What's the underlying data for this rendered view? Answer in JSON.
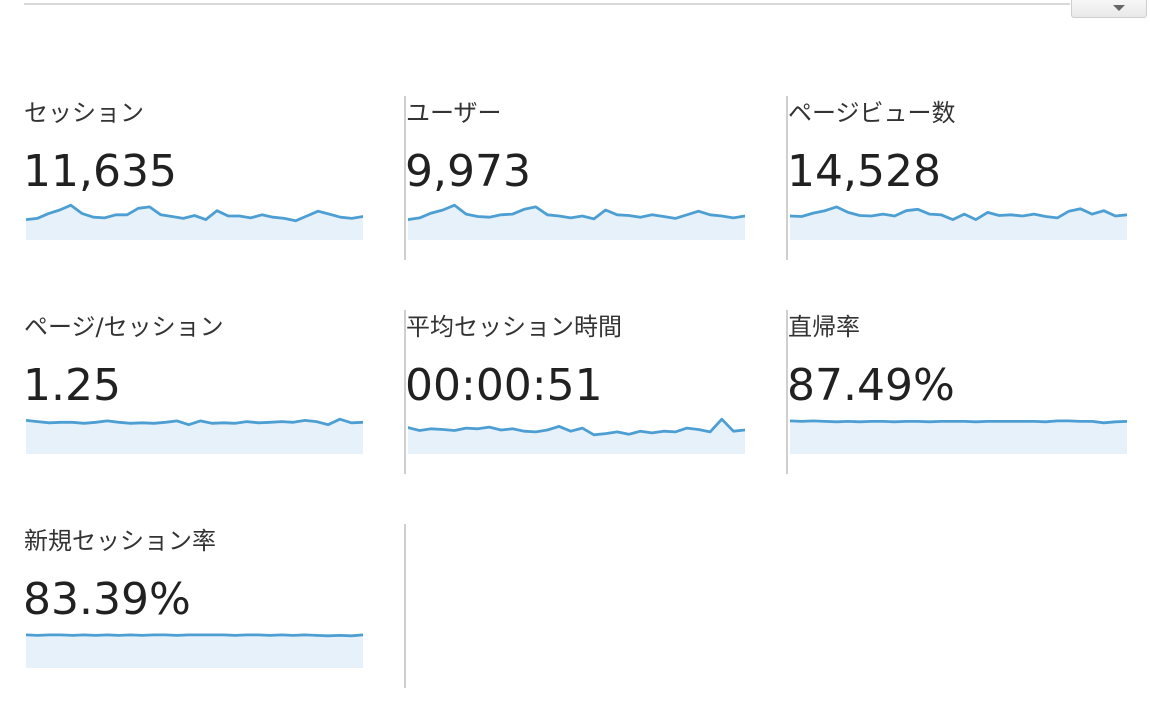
{
  "colors": {
    "accent": "#4d9fd3",
    "area_fill": "#e7f1fa",
    "divider": "#cfcfcf",
    "text": "#222222"
  },
  "toolbar": {
    "dropdown_icon": "chevron-down-icon"
  },
  "metrics": [
    {
      "id": "sessions",
      "label": "セッション",
      "value": "11,635",
      "trend": [
        0.35,
        0.4,
        0.6,
        0.75,
        0.95,
        0.6,
        0.45,
        0.42,
        0.55,
        0.55,
        0.82,
        0.88,
        0.55,
        0.48,
        0.4,
        0.52,
        0.35,
        0.72,
        0.5,
        0.5,
        0.42,
        0.55,
        0.45,
        0.4,
        0.3,
        0.5,
        0.7,
        0.58,
        0.45,
        0.4,
        0.48
      ]
    },
    {
      "id": "users",
      "label": "ユーザー",
      "value": "9,973",
      "trend": [
        0.35,
        0.42,
        0.62,
        0.75,
        0.95,
        0.58,
        0.48,
        0.45,
        0.55,
        0.58,
        0.78,
        0.88,
        0.55,
        0.5,
        0.42,
        0.5,
        0.38,
        0.75,
        0.55,
        0.52,
        0.45,
        0.55,
        0.48,
        0.4,
        0.55,
        0.7,
        0.55,
        0.5,
        0.42,
        0.5
      ]
    },
    {
      "id": "pageviews",
      "label": "ページビュー数",
      "value": "14,528",
      "trend": [
        0.5,
        0.48,
        0.62,
        0.72,
        0.88,
        0.65,
        0.52,
        0.5,
        0.58,
        0.5,
        0.72,
        0.78,
        0.58,
        0.55,
        0.35,
        0.58,
        0.35,
        0.65,
        0.52,
        0.55,
        0.5,
        0.58,
        0.48,
        0.42,
        0.7,
        0.8,
        0.58,
        0.72,
        0.5,
        0.55
      ]
    },
    {
      "id": "pages_per_session",
      "label": "ページ/セッション",
      "value": "1.25",
      "trend": [
        0.9,
        0.85,
        0.8,
        0.82,
        0.82,
        0.78,
        0.82,
        0.88,
        0.82,
        0.78,
        0.8,
        0.78,
        0.82,
        0.88,
        0.72,
        0.88,
        0.78,
        0.8,
        0.78,
        0.85,
        0.8,
        0.82,
        0.85,
        0.82,
        0.9,
        0.85,
        0.72,
        0.95,
        0.8,
        0.82
      ]
    },
    {
      "id": "avg_session_duration",
      "label": "平均セッション時間",
      "value": "00:00:51",
      "trend": [
        0.6,
        0.48,
        0.55,
        0.52,
        0.48,
        0.58,
        0.55,
        0.62,
        0.5,
        0.55,
        0.45,
        0.42,
        0.5,
        0.65,
        0.45,
        0.58,
        0.3,
        0.35,
        0.42,
        0.32,
        0.45,
        0.38,
        0.45,
        0.42,
        0.58,
        0.52,
        0.42,
        0.95,
        0.45,
        0.5
      ]
    },
    {
      "id": "bounce_rate",
      "label": "直帰率",
      "value": "87.49%",
      "trend": [
        0.88,
        0.86,
        0.88,
        0.86,
        0.84,
        0.86,
        0.84,
        0.86,
        0.86,
        0.84,
        0.86,
        0.86,
        0.84,
        0.86,
        0.86,
        0.86,
        0.84,
        0.86,
        0.86,
        0.86,
        0.86,
        0.86,
        0.84,
        0.88,
        0.88,
        0.86,
        0.86,
        0.8,
        0.84,
        0.86
      ]
    },
    {
      "id": "new_session_rate",
      "label": "新規セッション率",
      "value": "83.39%",
      "trend": [
        0.88,
        0.86,
        0.88,
        0.88,
        0.86,
        0.88,
        0.86,
        0.88,
        0.86,
        0.88,
        0.86,
        0.88,
        0.88,
        0.86,
        0.88,
        0.88,
        0.88,
        0.88,
        0.86,
        0.88,
        0.88,
        0.86,
        0.88,
        0.86,
        0.88,
        0.86,
        0.84,
        0.86,
        0.84,
        0.88
      ]
    }
  ]
}
